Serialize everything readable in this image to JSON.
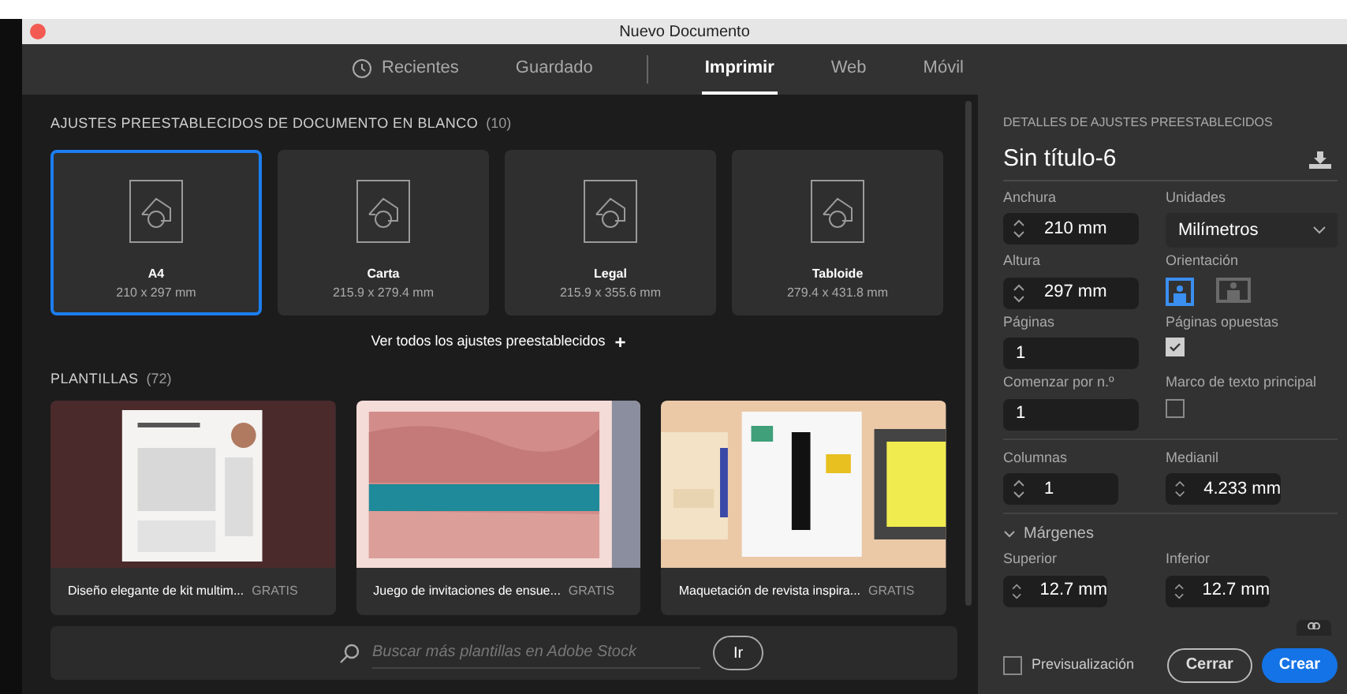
{
  "window": {
    "title": "Nuevo Documento"
  },
  "tabs": [
    {
      "label": "Recientes",
      "kind": "history",
      "selected": false
    },
    {
      "label": "Guardado",
      "kind": "plain",
      "selected": false
    },
    {
      "label": "Imprimir",
      "kind": "plain",
      "selected": true
    },
    {
      "label": "Web",
      "kind": "plain",
      "selected": false
    },
    {
      "label": "Móvil",
      "kind": "plain",
      "selected": false
    }
  ],
  "presets": {
    "heading": "AJUSTES PREESTABLECIDOS DE DOCUMENTO EN BLANCO",
    "count": "(10)",
    "items": [
      {
        "name": "A4",
        "size": "210 x 297 mm",
        "selected": true
      },
      {
        "name": "Carta",
        "size": "215.9 x 279.4 mm",
        "selected": false
      },
      {
        "name": "Legal",
        "size": "215.9 x 355.6 mm",
        "selected": false
      },
      {
        "name": "Tabloide",
        "size": "279.4 x 431.8 mm",
        "selected": false
      }
    ],
    "view_all": "Ver todos los ajustes preestablecidos",
    "view_all_mark": "+"
  },
  "templates": {
    "heading": "PLANTILLAS",
    "count": "(72)",
    "items": [
      {
        "title": "Diseño elegante de kit multim...",
        "price": "GRATIS",
        "kind": "resume"
      },
      {
        "title": "Juego de invitaciones de ensue...",
        "price": "GRATIS",
        "kind": "landscape"
      },
      {
        "title": "Maquetación de revista inspira...",
        "price": "GRATIS",
        "kind": "magazine"
      }
    ]
  },
  "search": {
    "placeholder": "Buscar más plantillas en Adobe Stock",
    "button": "Ir"
  },
  "details": {
    "heading": "DETALLES DE AJUSTES PREESTABLECIDOS",
    "name": "Sin título-6",
    "width": {
      "label": "Anchura",
      "value": "210 mm"
    },
    "units": {
      "label": "Unidades",
      "value": "Milímetros"
    },
    "height": {
      "label": "Altura",
      "value": "297 mm"
    },
    "orientation": {
      "label": "Orientación",
      "options": [
        {
          "kind": "portrait",
          "selected": true
        },
        {
          "kind": "landscape",
          "selected": false
        }
      ]
    },
    "pages": {
      "label": "Páginas",
      "value": "1"
    },
    "facing_pages": {
      "label": "Páginas opuestas",
      "checked": true
    },
    "start_page": {
      "label": "Comenzar por n.º",
      "value": "1"
    },
    "primary_text_frame": {
      "label": "Marco de texto principal",
      "checked": false
    },
    "columns": {
      "label": "Columnas",
      "value": "1"
    },
    "gutter": {
      "label": "Medianil",
      "value": "4.233 mm"
    },
    "margins": {
      "label": "Márgenes",
      "expanded": true,
      "top": {
        "label": "Superior",
        "value": "12.7 mm"
      },
      "bottom": {
        "label": "Inferior",
        "value": "12.7 mm"
      }
    }
  },
  "footer": {
    "preview": {
      "label": "Previsualización",
      "checked": false
    },
    "buttons": [
      {
        "label": "Cerrar",
        "kind": "secondary"
      },
      {
        "label": "Crear",
        "kind": "primary"
      }
    ]
  }
}
